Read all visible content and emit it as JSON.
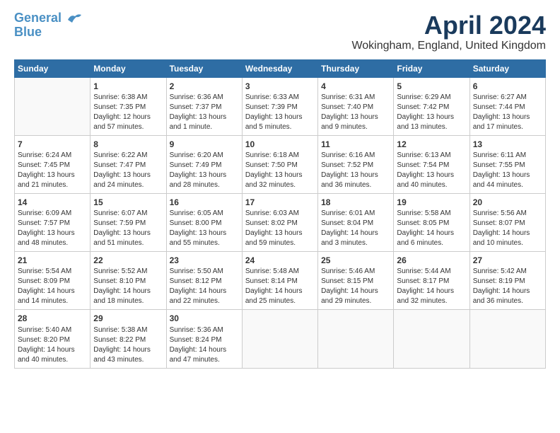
{
  "header": {
    "logo_line1": "General",
    "logo_line2": "Blue",
    "month": "April 2024",
    "location": "Wokingham, England, United Kingdom"
  },
  "weekdays": [
    "Sunday",
    "Monday",
    "Tuesday",
    "Wednesday",
    "Thursday",
    "Friday",
    "Saturday"
  ],
  "weeks": [
    [
      {
        "day": "",
        "text": ""
      },
      {
        "day": "1",
        "text": "Sunrise: 6:38 AM\nSunset: 7:35 PM\nDaylight: 12 hours\nand 57 minutes."
      },
      {
        "day": "2",
        "text": "Sunrise: 6:36 AM\nSunset: 7:37 PM\nDaylight: 13 hours\nand 1 minute."
      },
      {
        "day": "3",
        "text": "Sunrise: 6:33 AM\nSunset: 7:39 PM\nDaylight: 13 hours\nand 5 minutes."
      },
      {
        "day": "4",
        "text": "Sunrise: 6:31 AM\nSunset: 7:40 PM\nDaylight: 13 hours\nand 9 minutes."
      },
      {
        "day": "5",
        "text": "Sunrise: 6:29 AM\nSunset: 7:42 PM\nDaylight: 13 hours\nand 13 minutes."
      },
      {
        "day": "6",
        "text": "Sunrise: 6:27 AM\nSunset: 7:44 PM\nDaylight: 13 hours\nand 17 minutes."
      }
    ],
    [
      {
        "day": "7",
        "text": "Sunrise: 6:24 AM\nSunset: 7:45 PM\nDaylight: 13 hours\nand 21 minutes."
      },
      {
        "day": "8",
        "text": "Sunrise: 6:22 AM\nSunset: 7:47 PM\nDaylight: 13 hours\nand 24 minutes."
      },
      {
        "day": "9",
        "text": "Sunrise: 6:20 AM\nSunset: 7:49 PM\nDaylight: 13 hours\nand 28 minutes."
      },
      {
        "day": "10",
        "text": "Sunrise: 6:18 AM\nSunset: 7:50 PM\nDaylight: 13 hours\nand 32 minutes."
      },
      {
        "day": "11",
        "text": "Sunrise: 6:16 AM\nSunset: 7:52 PM\nDaylight: 13 hours\nand 36 minutes."
      },
      {
        "day": "12",
        "text": "Sunrise: 6:13 AM\nSunset: 7:54 PM\nDaylight: 13 hours\nand 40 minutes."
      },
      {
        "day": "13",
        "text": "Sunrise: 6:11 AM\nSunset: 7:55 PM\nDaylight: 13 hours\nand 44 minutes."
      }
    ],
    [
      {
        "day": "14",
        "text": "Sunrise: 6:09 AM\nSunset: 7:57 PM\nDaylight: 13 hours\nand 48 minutes."
      },
      {
        "day": "15",
        "text": "Sunrise: 6:07 AM\nSunset: 7:59 PM\nDaylight: 13 hours\nand 51 minutes."
      },
      {
        "day": "16",
        "text": "Sunrise: 6:05 AM\nSunset: 8:00 PM\nDaylight: 13 hours\nand 55 minutes."
      },
      {
        "day": "17",
        "text": "Sunrise: 6:03 AM\nSunset: 8:02 PM\nDaylight: 13 hours\nand 59 minutes."
      },
      {
        "day": "18",
        "text": "Sunrise: 6:01 AM\nSunset: 8:04 PM\nDaylight: 14 hours\nand 3 minutes."
      },
      {
        "day": "19",
        "text": "Sunrise: 5:58 AM\nSunset: 8:05 PM\nDaylight: 14 hours\nand 6 minutes."
      },
      {
        "day": "20",
        "text": "Sunrise: 5:56 AM\nSunset: 8:07 PM\nDaylight: 14 hours\nand 10 minutes."
      }
    ],
    [
      {
        "day": "21",
        "text": "Sunrise: 5:54 AM\nSunset: 8:09 PM\nDaylight: 14 hours\nand 14 minutes."
      },
      {
        "day": "22",
        "text": "Sunrise: 5:52 AM\nSunset: 8:10 PM\nDaylight: 14 hours\nand 18 minutes."
      },
      {
        "day": "23",
        "text": "Sunrise: 5:50 AM\nSunset: 8:12 PM\nDaylight: 14 hours\nand 22 minutes."
      },
      {
        "day": "24",
        "text": "Sunrise: 5:48 AM\nSunset: 8:14 PM\nDaylight: 14 hours\nand 25 minutes."
      },
      {
        "day": "25",
        "text": "Sunrise: 5:46 AM\nSunset: 8:15 PM\nDaylight: 14 hours\nand 29 minutes."
      },
      {
        "day": "26",
        "text": "Sunrise: 5:44 AM\nSunset: 8:17 PM\nDaylight: 14 hours\nand 32 minutes."
      },
      {
        "day": "27",
        "text": "Sunrise: 5:42 AM\nSunset: 8:19 PM\nDaylight: 14 hours\nand 36 minutes."
      }
    ],
    [
      {
        "day": "28",
        "text": "Sunrise: 5:40 AM\nSunset: 8:20 PM\nDaylight: 14 hours\nand 40 minutes."
      },
      {
        "day": "29",
        "text": "Sunrise: 5:38 AM\nSunset: 8:22 PM\nDaylight: 14 hours\nand 43 minutes."
      },
      {
        "day": "30",
        "text": "Sunrise: 5:36 AM\nSunset: 8:24 PM\nDaylight: 14 hours\nand 47 minutes."
      },
      {
        "day": "",
        "text": ""
      },
      {
        "day": "",
        "text": ""
      },
      {
        "day": "",
        "text": ""
      },
      {
        "day": "",
        "text": ""
      }
    ]
  ]
}
